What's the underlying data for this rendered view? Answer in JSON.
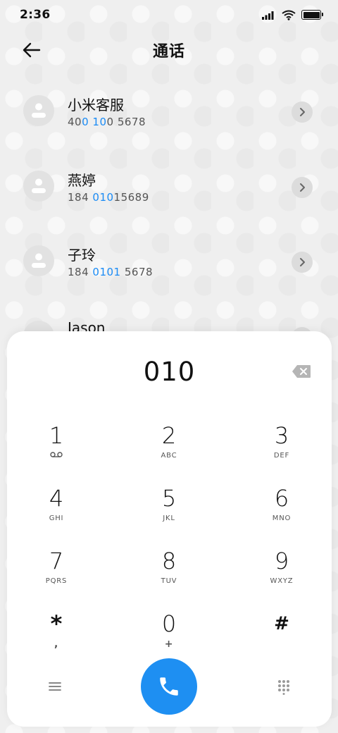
{
  "status_bar": {
    "time": "2:36",
    "icons": [
      "signal-icon",
      "wifi-icon",
      "battery-icon"
    ]
  },
  "header": {
    "title": "通话",
    "back_icon": "arrow-left-icon"
  },
  "contacts": [
    {
      "name": "小米客服",
      "number_parts": [
        "40",
        "0",
        " ",
        "10",
        "0 5678"
      ]
    },
    {
      "name": "燕婷",
      "number_parts": [
        "184 ",
        "010",
        "15689",
        "",
        ""
      ]
    },
    {
      "name": "子玲",
      "number_parts": [
        "184 ",
        "0101",
        " 5678",
        "",
        ""
      ]
    },
    {
      "name": "Jason"
    }
  ],
  "dialpad": {
    "entered_number": "010",
    "keys": [
      {
        "num": "1",
        "sub": "",
        "sub_icon": "voicemail-icon"
      },
      {
        "num": "2",
        "sub": "ABC"
      },
      {
        "num": "3",
        "sub": "DEF"
      },
      {
        "num": "4",
        "sub": "GHI"
      },
      {
        "num": "5",
        "sub": "JKL"
      },
      {
        "num": "6",
        "sub": "MNO"
      },
      {
        "num": "7",
        "sub": "PQRS"
      },
      {
        "num": "8",
        "sub": "TUV"
      },
      {
        "num": "9",
        "sub": "WXYZ"
      },
      {
        "num": "*",
        "sub": ","
      },
      {
        "num": "0",
        "sub": "+"
      },
      {
        "num": "#",
        "sub": ""
      }
    ],
    "bottom_icons": [
      "menu-icon",
      "phone-icon",
      "keypad-icon"
    ]
  },
  "colors": {
    "accent": "#1e8ff2",
    "highlight_text": "#1a8bf5",
    "background": "#efefef"
  }
}
